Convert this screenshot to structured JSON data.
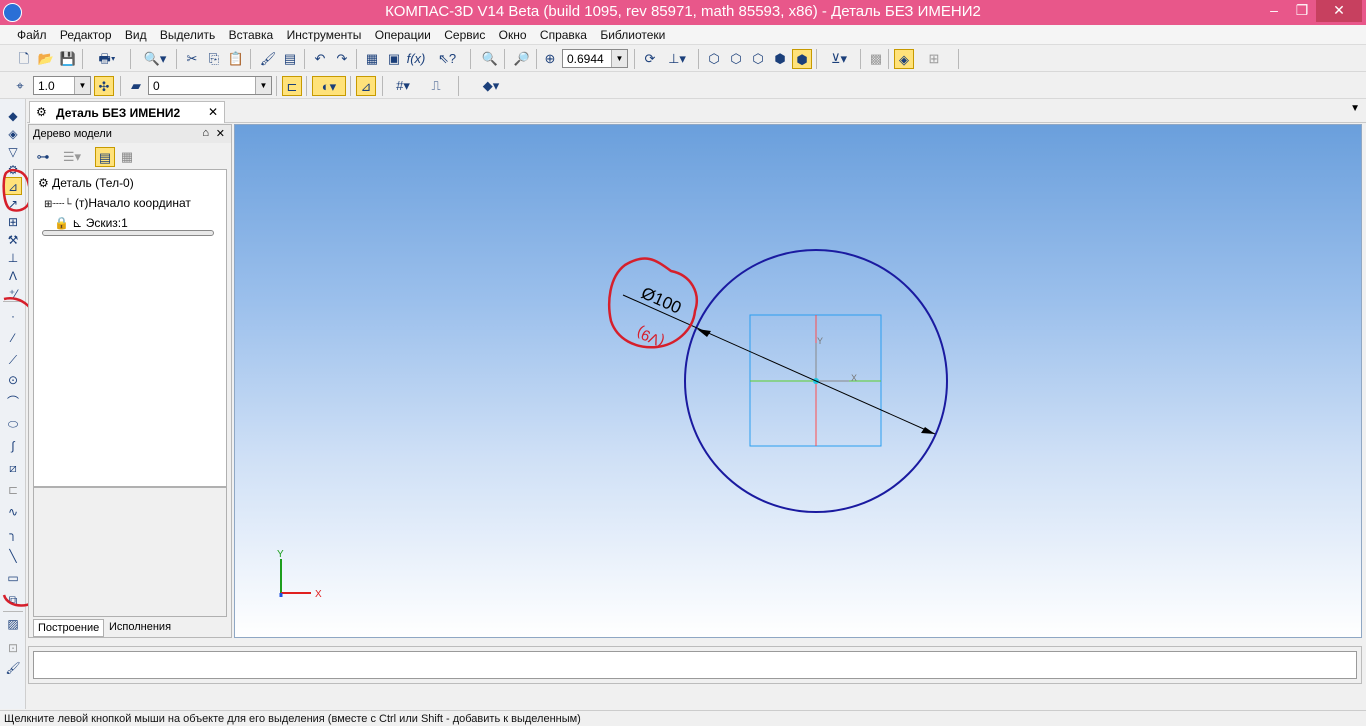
{
  "window": {
    "title": "КОМПАС-3D V14 Beta (build 1095, rev 85971, math 85593, x86) - Деталь БЕЗ ИМЕНИ2",
    "minimize": "–",
    "restore": "❐",
    "close": "✕"
  },
  "menu": [
    "Файл",
    "Редактор",
    "Вид",
    "Выделить",
    "Вставка",
    "Инструменты",
    "Операции",
    "Сервис",
    "Окно",
    "Справка",
    "Библиотеки"
  ],
  "toolbar1": {
    "zoom_value": "0.6944"
  },
  "toolbar2": {
    "step_value": "1.0",
    "layer_value": "0"
  },
  "doc_tab": {
    "label": "Деталь БЕЗ ИМЕНИ2",
    "close": "✕"
  },
  "tree_panel": {
    "title": "Дерево модели",
    "pin": "⌂",
    "close": "✕",
    "nodes": [
      {
        "label": "Деталь (Тел-0)"
      },
      {
        "label": "(т)Начало координат"
      },
      {
        "label": "Эскиз:1"
      }
    ],
    "tabs": [
      "Построение",
      "Исполнения"
    ]
  },
  "sketch": {
    "dimension_text": "Ø100",
    "handwritten_note": "(V9)",
    "axis_x": "X",
    "axis_y": "Y",
    "circle_color": "#1a1aa0",
    "dimension_color": "#000000",
    "annotation_color": "#d61f2b"
  },
  "status": {
    "text": "Щелкните левой кнопкой мыши на объекте для его выделения (вместе с Ctrl или Shift - добавить к выделенным)"
  }
}
